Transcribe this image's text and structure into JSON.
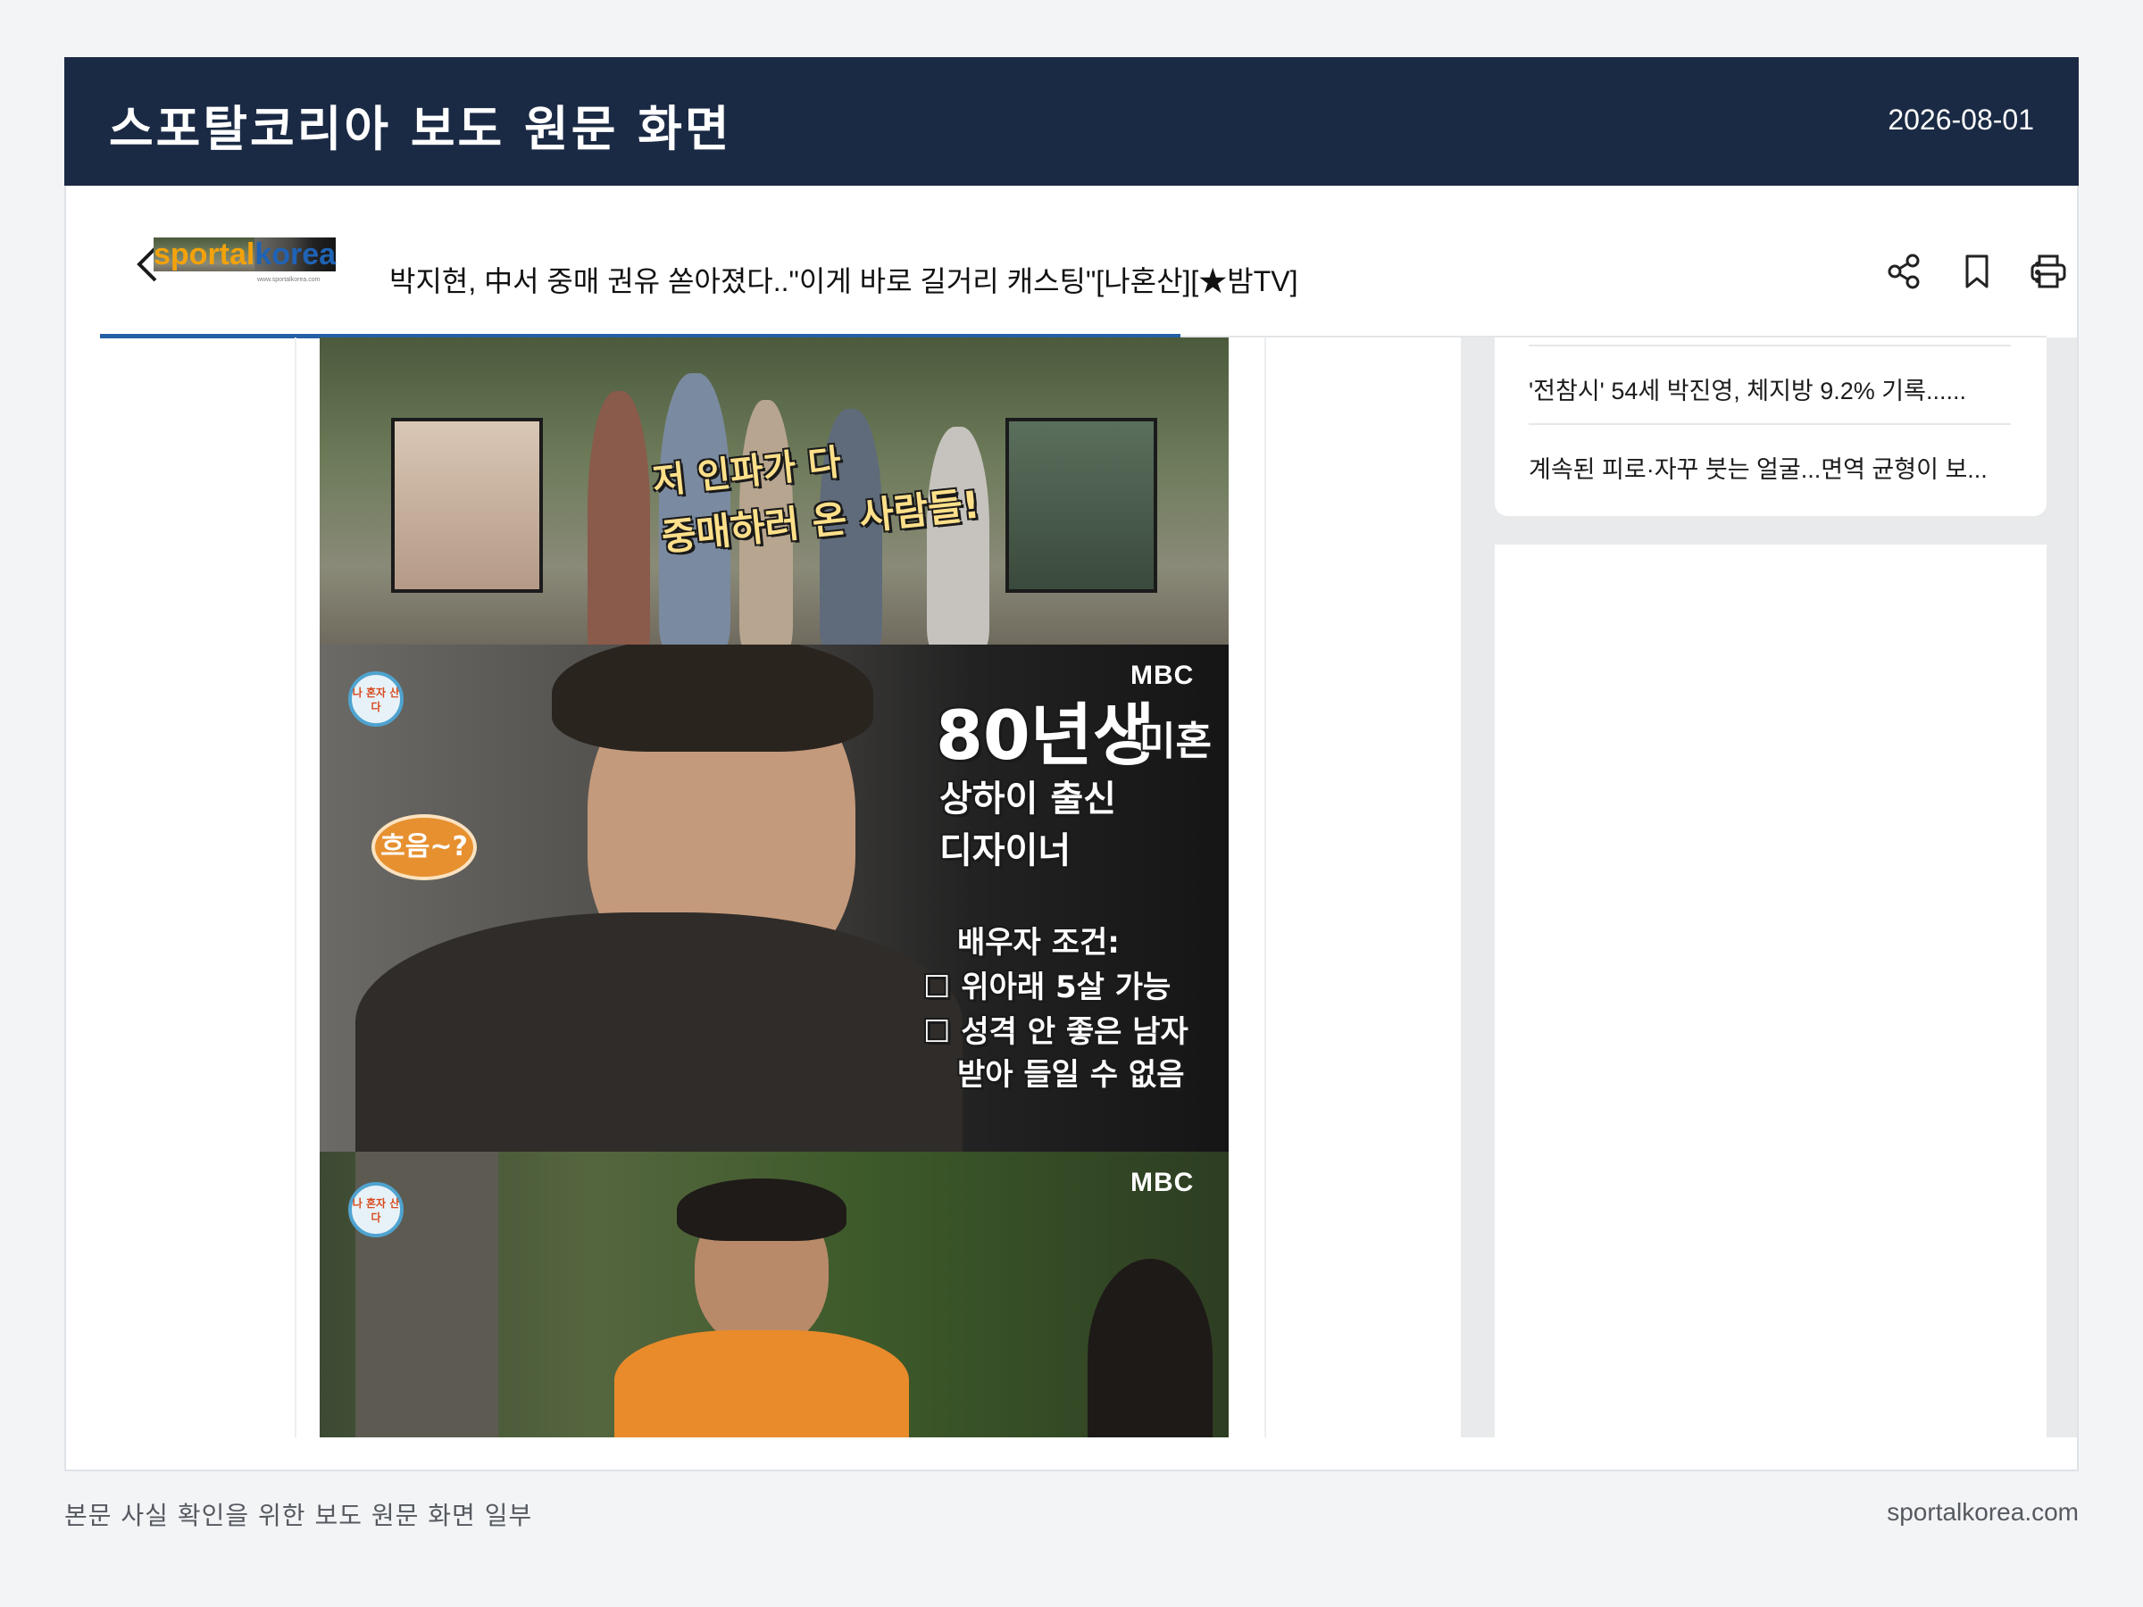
{
  "header": {
    "title": "스포탈코리아 보도 원문 화면",
    "date": "2026-08-01"
  },
  "app": {
    "logo_part1": "sport",
    "logo_part2": "al",
    "logo_part3": "korea",
    "logo_sub": "www.sportalkorea.com",
    "article_title": "박지현, 中서 중매 권유 쏟아졌다..\"이게 바로 길거리 캐스팅\"[나혼산][★밤TV]",
    "icons": [
      "back-icon",
      "share-icon",
      "bookmark-icon",
      "print-icon",
      "more-icon"
    ]
  },
  "sidebar": {
    "items": [
      {
        "label": "'전참시' 54세 박진영, 체지방 9.2% 기록......"
      },
      {
        "label": "계속된 피로·자꾸 붓는 얼굴...면역 균형이 보..."
      }
    ]
  },
  "photo": {
    "panel1": {
      "caption_line1": "저 인파가 다",
      "caption_line2": "중매하러 온 사람들!"
    },
    "panel2": {
      "mbc": "MBC",
      "badge": "나 혼자 산다",
      "exclaim": "흐음~?",
      "age_big": "80년생",
      "age_small": "미혼",
      "origin_line1": "상하이 출신",
      "origin_line2": "디자이너",
      "cond_title": "배우자 조건:",
      "cond_1": "☐ 위아래 5살 가능",
      "cond_2": "☐ 성격 안 좋은 남자",
      "cond_3": "받아 들일 수 없음"
    },
    "panel3": {
      "mbc": "MBC",
      "badge": "나 혼자 산다"
    }
  },
  "footer": {
    "note": "본문 사실 확인을 위한 보도 원문 화면 일부",
    "domain": "sportalkorea.com"
  }
}
